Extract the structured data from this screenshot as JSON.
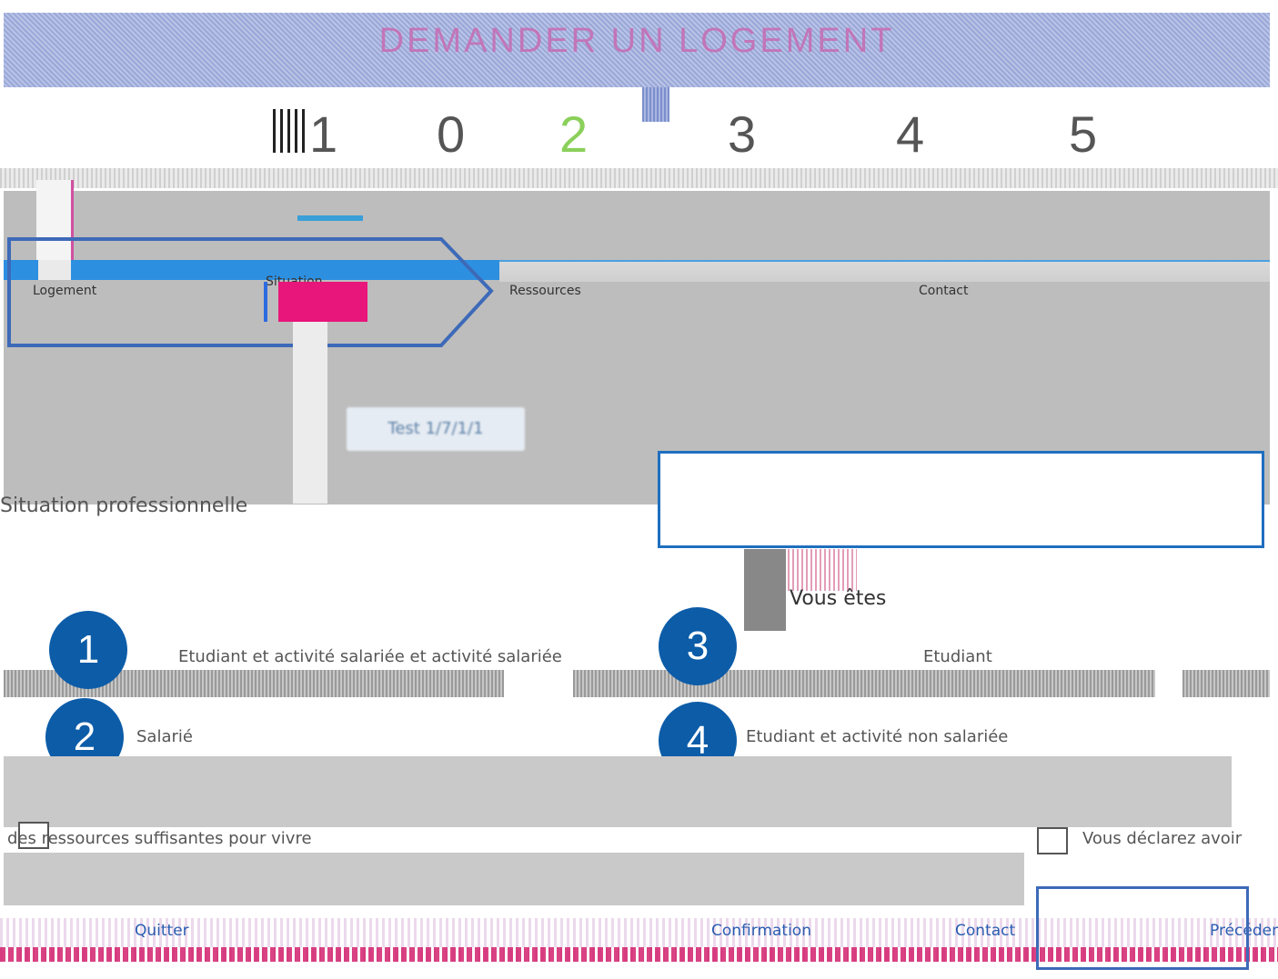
{
  "header": {
    "title": "DEMANDER UN LOGEMENT",
    "colors": {
      "banner": "#9aa8d8",
      "title": "#c56fb5"
    }
  },
  "steps": {
    "numbers": [
      "1",
      "0",
      "2",
      "3",
      "4",
      "5"
    ],
    "labels": [
      "Logement",
      "Situation",
      "Ressources",
      "Contact"
    ]
  },
  "main": {
    "blurred_label": "Test 1/7/1/1",
    "situation_text": "Situation professionnelle",
    "vous_etes": "Vous êtes"
  },
  "options": {
    "opt1": "Etudiant et activité salariée et activité salariée",
    "opt2": "Salarié",
    "opt3": "Etudiant",
    "opt4": "Etudiant et activité non salariée",
    "resources": "des ressources suffisantes pour vivre",
    "declare": "Vous déclarez avoir",
    "badges": [
      "1",
      "2",
      "3",
      "4"
    ]
  },
  "footer": {
    "quit_label": "Quitter",
    "confirm_label": "Confirmation",
    "contact_label": "Contact",
    "prev_label": "Précédent"
  },
  "colors": {
    "accent_blue": "#2d8fe0",
    "badge": "#0c5ca8",
    "pink": "#e8157a",
    "box_outline": "#1f6fbf"
  }
}
